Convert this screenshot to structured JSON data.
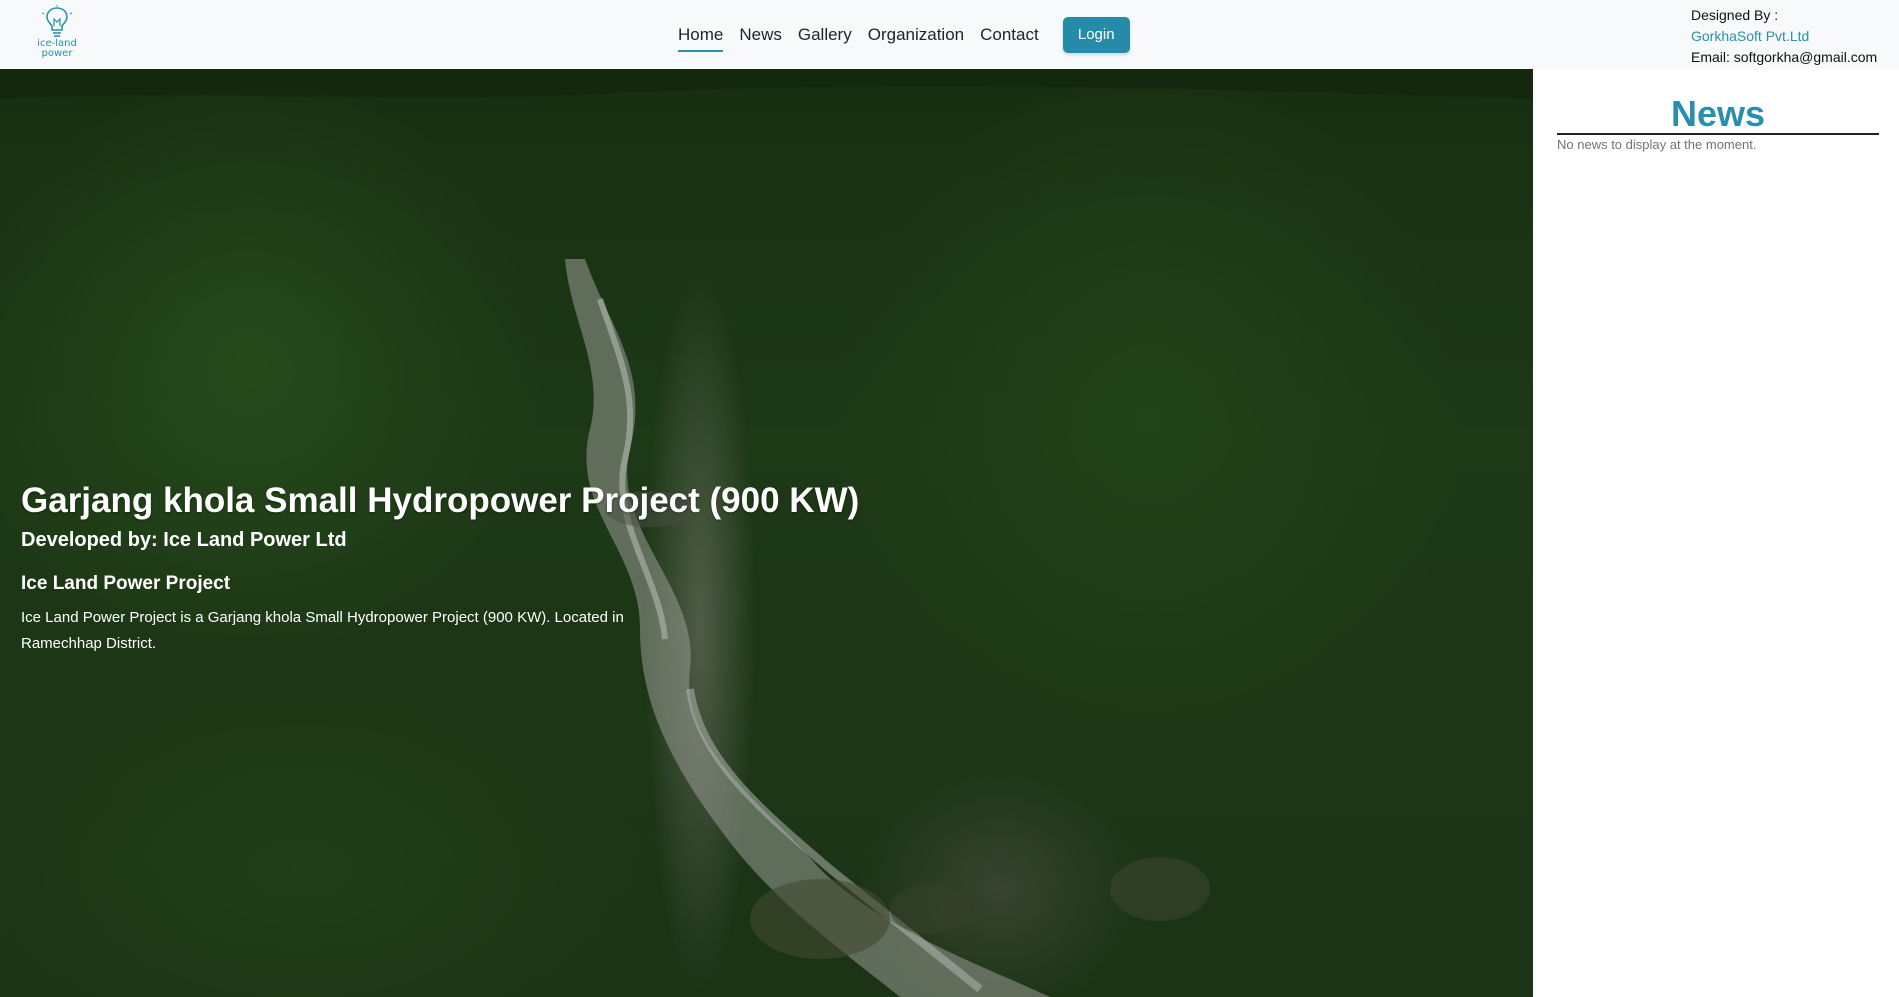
{
  "logo": {
    "line1": "ice-land",
    "line2": "power",
    "icon": "lightbulb-icon",
    "color": "#2a8fae"
  },
  "nav": {
    "items": [
      "Home",
      "News",
      "Gallery",
      "Organization",
      "Contact"
    ],
    "active": "Home",
    "login_label": "Login"
  },
  "designer": {
    "label": "Designed By :",
    "company": "GorkhaSoft Pvt.Ltd",
    "email": "Email: softgorkha@gmail.com"
  },
  "hero": {
    "title": "Garjang khola Small Hydropower Project (900 KW)",
    "developer": "Developed by: Ice Land Power Ltd",
    "project_name": "Ice Land Power Project",
    "description": "Ice Land Power Project is a Garjang khola Small Hydropower Project (900 KW). Located in Ramechhap District."
  },
  "news": {
    "title": "News",
    "empty_message": "No news to display at the moment."
  },
  "colors": {
    "accent": "#2a8fae",
    "button": "#268ba8"
  }
}
